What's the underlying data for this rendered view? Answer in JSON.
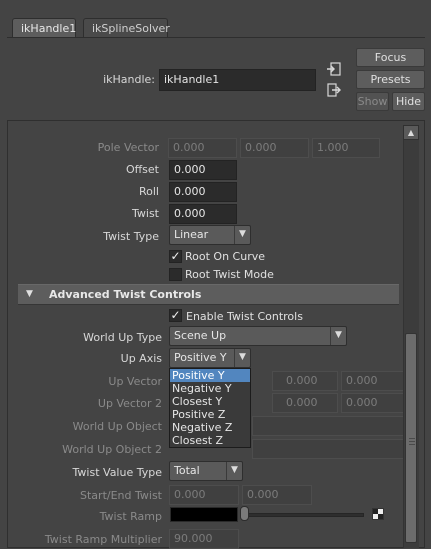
{
  "tabs": [
    {
      "label": "ikHandle1",
      "active": true
    },
    {
      "label": "ikSplineSolver",
      "active": false
    }
  ],
  "header": {
    "node_label": "ikHandle:",
    "node_value": "ikHandle1",
    "focus_label": "Focus",
    "presets_label": "Presets",
    "show_label": "Show",
    "hide_label": "Hide"
  },
  "attributes": {
    "pole_vector": {
      "label": "Pole Vector",
      "values": [
        "0.000",
        "0.000",
        "1.000"
      ]
    },
    "offset": {
      "label": "Offset",
      "value": "0.000"
    },
    "roll": {
      "label": "Roll",
      "value": "0.000"
    },
    "twist": {
      "label": "Twist",
      "value": "0.000"
    },
    "twist_type": {
      "label": "Twist Type",
      "value": "Linear"
    },
    "root_on_curve": {
      "label": "Root On Curve",
      "checked": true
    },
    "root_twist_mode": {
      "label": "Root Twist Mode",
      "checked": false
    }
  },
  "advanced": {
    "section_title": "Advanced Twist Controls",
    "enable": {
      "label": "Enable Twist Controls",
      "checked": true
    },
    "world_up_type": {
      "label": "World Up Type",
      "value": "Scene Up"
    },
    "up_axis": {
      "label": "Up Axis",
      "value": "Positive Y"
    },
    "up_vector": {
      "label": "Up Vector",
      "values": [
        "0.000",
        "0.000"
      ]
    },
    "up_vector_2": {
      "label": "Up Vector 2",
      "values": [
        "0.000",
        "0.000"
      ]
    },
    "world_up_object": {
      "label": "World Up Object",
      "value": ""
    },
    "world_up_object_2": {
      "label": "World Up Object 2",
      "value": ""
    },
    "twist_value_type": {
      "label": "Twist Value Type",
      "value": "Total"
    },
    "start_end_twist": {
      "label": "Start/End Twist",
      "values": [
        "0.000",
        "0.000"
      ]
    },
    "twist_ramp": {
      "label": "Twist Ramp"
    },
    "twist_ramp_multiplier": {
      "label": "Twist Ramp Multiplier",
      "value": "90.000"
    }
  },
  "up_axis_options": [
    "Positive Y",
    "Negative Y",
    "Closest Y",
    "Positive Z",
    "Negative Z",
    "Closest Z"
  ],
  "up_axis_selected_index": 0,
  "colors": {
    "background": "#444444",
    "highlight": "#5286bf",
    "field": "#2b2b2b"
  }
}
